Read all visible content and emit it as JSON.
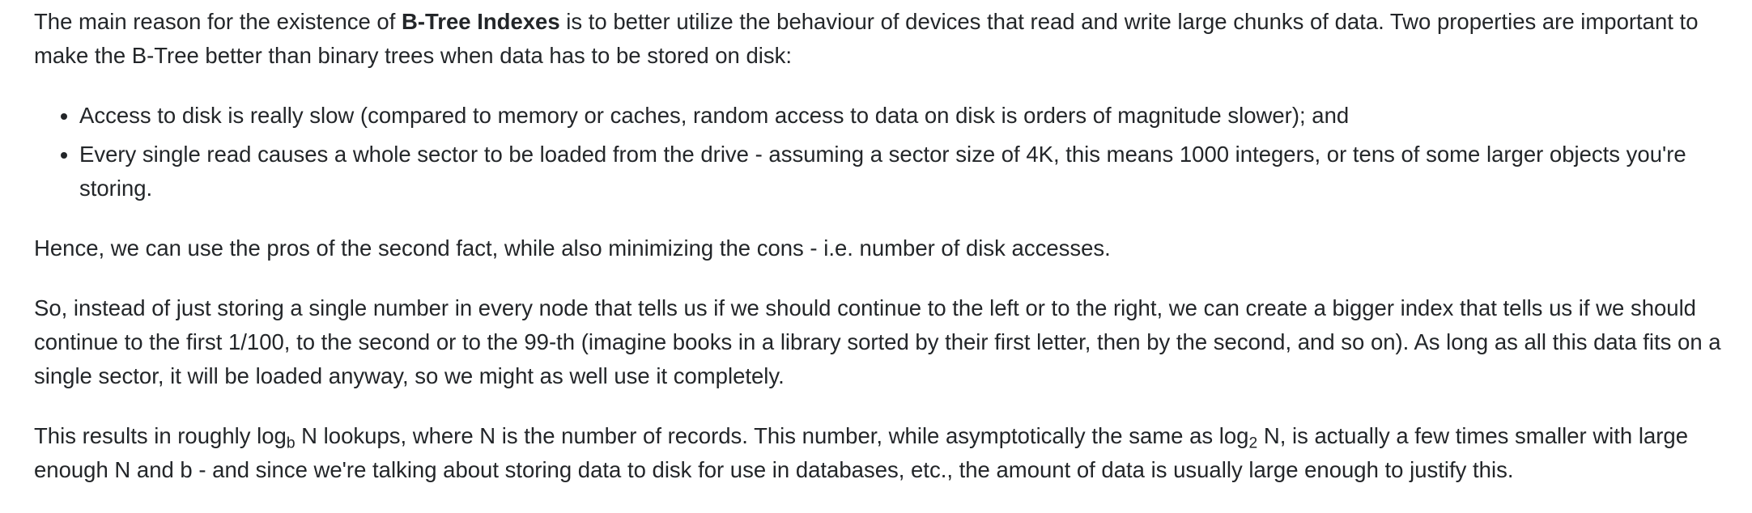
{
  "paragraph_1": {
    "before_bold": "The main reason for the existence of ",
    "bold": "B-Tree Indexes",
    "after_bold": " is to better utilize the behaviour of devices that read and write large chunks of data. Two properties are important to make the B-Tree better than binary trees when data has to be stored on disk:"
  },
  "bullets": [
    "Access to disk is really slow (compared to memory or caches, random access to data on disk is orders of magnitude slower); and",
    "Every single read causes a whole sector to be loaded from the drive - assuming a sector size of 4K, this means 1000 integers, or tens of some larger objects you're storing."
  ],
  "paragraph_2": "Hence, we can use the pros of the second fact, while also minimizing the cons - i.e. number of disk accesses.",
  "paragraph_3": "So, instead of just storing a single number in every node that tells us if we should continue to the left or to the right, we can create a bigger index that tells us if we should continue to the first 1/100, to the second or to the 99-th (imagine books in a library sorted by their first letter, then by the second, and so on). As long as all this data fits on a single sector, it will be loaded anyway, so we might as well use it completely.",
  "paragraph_4": {
    "part_1": "This results in roughly log",
    "sub_1": "b",
    "part_2": " N lookups, where N is the number of records. This number, while asymptotically the same as log",
    "sub_2": "2",
    "part_3": " N, is actually a few times smaller with large enough N and b - and since we're talking about storing data to disk for use in databases, etc., the amount of data is usually large enough to justify this."
  }
}
